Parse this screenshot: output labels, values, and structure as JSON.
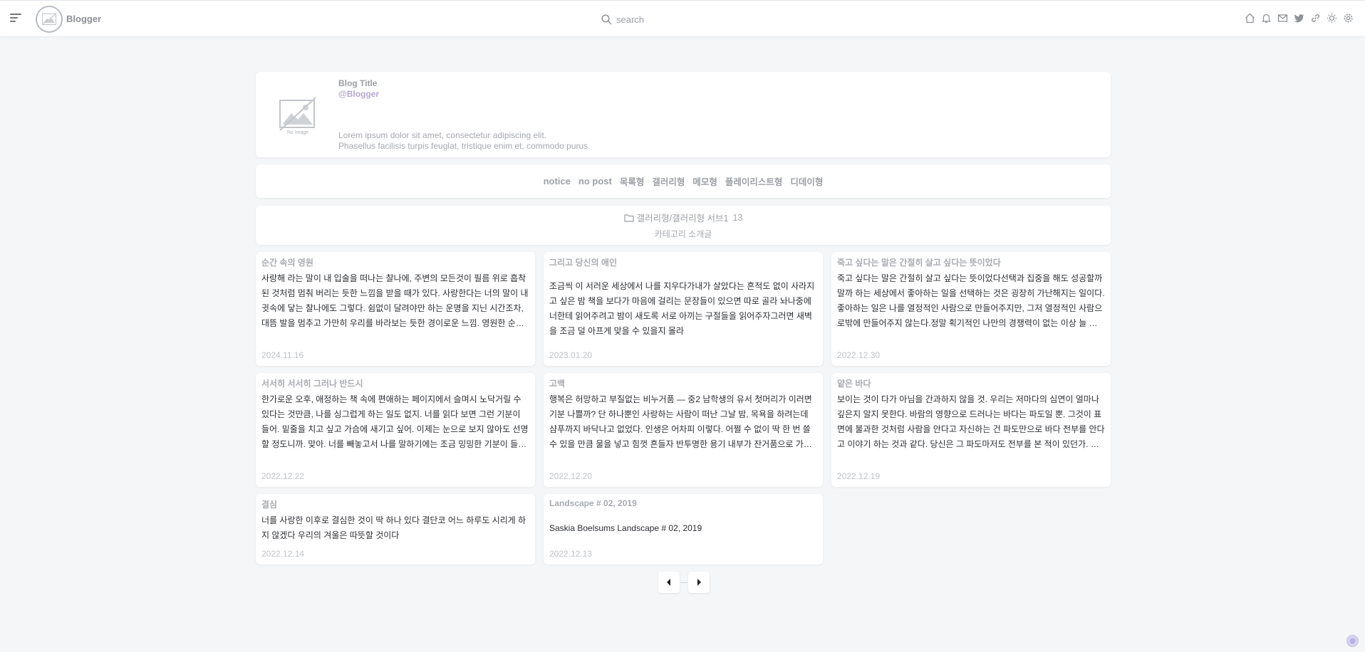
{
  "header": {
    "logo_text": "Blogger",
    "search_placeholder": "search",
    "tools": [
      "home-icon",
      "bell-icon",
      "mail-icon",
      "twitter-icon",
      "link-icon",
      "sun-icon",
      "gear-icon"
    ]
  },
  "profile": {
    "noimage_label": "No Image",
    "title": "Blog Title",
    "handle": "@Blogger",
    "desc_line1": "Lorem ipsum dolor sit amet, consectetur adipiscing elit.",
    "desc_line2": "Phasellus facilisis turpis feuglat, tristique enim et, commodo purus."
  },
  "nav": {
    "items": [
      "notice",
      "no post",
      "목록형",
      "갤러리형",
      "메모형",
      "플레이리스트형",
      "디데이형"
    ]
  },
  "category": {
    "path": "갤러리형/갤러리형 서브1",
    "count": "13",
    "description": "카테고리 소개글"
  },
  "posts": [
    {
      "title": "순간 속의 영원",
      "body": "사랑해 라는 말이 내 입술을 떠나는 찰나에, 주변의 모든것이 필름 위로 흡착된 것처럼 멈춰 버리는 듯한 느낌을 받을 때가 있다. 사랑한다는 너의 말이 내 귓속에 닿는 찰나에도 그렇다. 쉼없이 달려야만 하는 운명을 지닌 시간조차, 대뜸 발을 멈추고 가만히 우리를 바라보는 듯한 경이로운 느낌. 영원한 순간은 존재하지 않는다. 우리는 순간 속에서 영원을 경험한다.",
      "date": "2024.11.16"
    },
    {
      "title": "그리고 당신의 애인",
      "body": "조금씩 이 서러운 세상에서 나를 지우다가내가 살았다는 흔적도 없이 사라지고 싶은 밤 책을 보다가 마음에 걸리는 문장들이 있으면 따로 골라 놔나중에 너한테 읽어주려고 밤이 새도록 서로 아끼는 구절들을 읽어주자그러면 새벽을 조금 덜 아프게 맞을 수 있을지 몰라",
      "date": "2023.01.20"
    },
    {
      "title": "죽고 싶다는 말은 간절히 살고 싶다는 뜻이었다",
      "body": "죽고 싶다는 말은 간절히 살고 싶다는 뜻이었다선택과 집중을 해도 성공할까 말까 하는 세상에서 좋아하는 일을 선택하는 것은 굉장히 가난해지는 일이다. 좋아하는 일은 나를 열정적인 사람으로 만들어주지만, 그저 열정적인 사람으로밖에 만들어주지 않는다.정말 획기적인 나만의 경쟁력이 없는 이상 늘 평균 언저리를 맴돌 뿐이며, 그러다가 결국 이 사회에서 도태되고 만다.",
      "date": "2022.12.30"
    },
    {
      "title": "서서히 서서히 그러나 반드시",
      "body": "한가로운 오후, 애정하는 책 속에 편애하는 페이지에서 슬며시 노닥거릴 수 있다는 것만큼, 나를 싱그럽게 하는 일도 없지. 너를 읽다 보면 그런 기분이 들어. 밑줄을 치고 싶고 가슴에 새기고 싶어. 이제는 눈으로 보지 않아도 선명할 정도니까. 맞아. 너를 빼놓고서 나를 말하기에는 조금 밍밍한 기분이 들어. 우리는 하나는 아니지만 그렇다고 남이라고 하기엔 아쉬운 느낌이잖아.",
      "date": "2022.12.22"
    },
    {
      "title": "고백",
      "body": "행복은 허망하고 부질없는 비누거품 — 중2 남학생의 유서 첫머리가 이러면 기분 나쁠까? 단 하나뿐인 사랑하는 사람이 떠난 그날 밤, 목욕을 하려는데 샴푸까지 바닥나고 없었다. 인생은 어차피 이렇다. 어쩔 수 없이 딱 한 번 쓸 수 있을 만큼 물을 넣고 힘껏 흔들자 반투명한 용기 내부가 잔거품으로 가득 찼다. 그 순간 생각했다. 이건 나다. 텅 빈 내부에 남아 있을까말까 한 행복을 계속 흔들어 부풀려왔다.",
      "date": "2022.12.20"
    },
    {
      "title": "얕은 바다",
      "body": "보이는 것이 다가 아님을 간과하지 않을 것. 우리는 저마다의 심연이 얼마나 깊은지 알지 못한다. 바람의 영향으로 드러나는 바다는 파도일 뿐. 그것이 표면에 불과한 것처럼 사람을 안다고 자신하는 건 파도만으로 바다 전부를 안다고 이야기 하는 것과 같다. 당신은 그 파도마저도 전부를 본 적이 있던가. 우리는 저마다의 얕은 바다만을 볼 뿐이다.",
      "date": "2022.12.19"
    },
    {
      "title": "결심",
      "body": "너를 사랑한 이후로 결심한 것이 딱 하나 있다 결단코 어느 하루도 시리게 하지 않겠다 우리의 겨울은 따뜻할 것이다",
      "date": "2022.12.14"
    },
    {
      "title": "Landscape # 02, 2019",
      "body": "Saskia Boelsums Landscape # 02, 2019",
      "date": "2022.12.13"
    }
  ],
  "pagination": {
    "prev": "prev-icon",
    "separator": "—",
    "next": "next-icon"
  },
  "colors": {
    "accent_handle": "#b6a8d0",
    "muted": "#9c9fa5",
    "background": "#f5f6f8"
  }
}
